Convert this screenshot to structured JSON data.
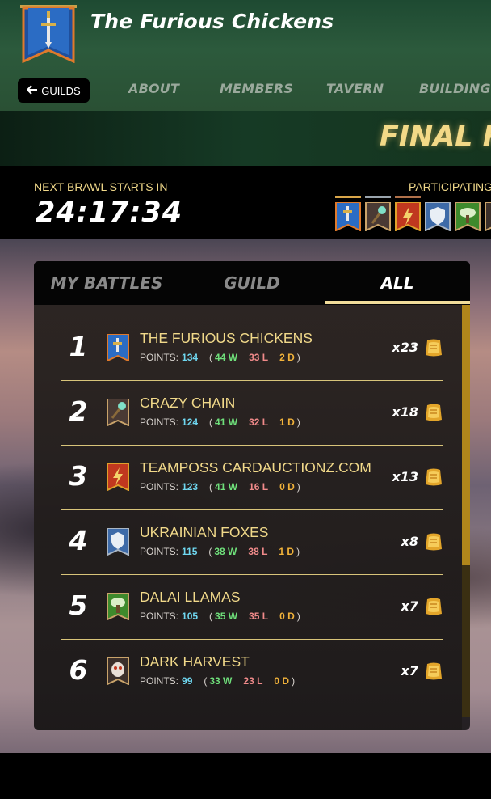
{
  "header": {
    "guild_name": "The Furious Chickens",
    "back_button_label": "GUILDS",
    "tabs": [
      {
        "label": "ABOUT"
      },
      {
        "label": "MEMBERS"
      },
      {
        "label": "TAVERN"
      },
      {
        "label": "BUILDINGS"
      }
    ]
  },
  "final_strip": {
    "text": "FINAL RE"
  },
  "brawl": {
    "next_label": "NEXT BRAWL STARTS IN",
    "timer": "24:17:34",
    "participating_label": "PARTICIPATING"
  },
  "panel": {
    "tabs": [
      {
        "label": "MY BATTLES",
        "active": false
      },
      {
        "label": "GUILD",
        "active": false
      },
      {
        "label": "ALL",
        "active": true
      }
    ],
    "points_label": "POINTS:",
    "rows": [
      {
        "rank": "1",
        "name": "THE FURIOUS CHICKENS",
        "points": "134",
        "wins": "44 W",
        "losses": "33 L",
        "draws": "2 D",
        "count": "x23",
        "banner": "sword-banner-icon"
      },
      {
        "rank": "2",
        "name": "CRAZY CHAIN",
        "points": "124",
        "wins": "41 W",
        "losses": "32 L",
        "draws": "1 D",
        "count": "x18",
        "banner": "staff-banner-icon"
      },
      {
        "rank": "3",
        "name": "TEAMPOSS CARDAUCTIONZ.COM",
        "points": "123",
        "wins": "41 W",
        "losses": "16 L",
        "draws": "0 D",
        "count": "x13",
        "banner": "lightning-banner-icon"
      },
      {
        "rank": "4",
        "name": "UKRAINIAN FOXES",
        "points": "115",
        "wins": "38 W",
        "losses": "38 L",
        "draws": "1 D",
        "count": "x8",
        "banner": "shield-banner-icon"
      },
      {
        "rank": "5",
        "name": "DALAI LLAMAS",
        "points": "105",
        "wins": "35 W",
        "losses": "35 L",
        "draws": "0 D",
        "count": "x7",
        "banner": "tree-banner-icon"
      },
      {
        "rank": "6",
        "name": "DARK HARVEST",
        "points": "99",
        "wins": "33 W",
        "losses": "23 L",
        "draws": "0 D",
        "count": "x7",
        "banner": "owl-banner-icon"
      }
    ]
  },
  "colors": {
    "accent_gold": "#f1d98a",
    "points_cyan": "#6fd7f0",
    "wins_green": "#6fe07b",
    "losses_red": "#f08a8a",
    "draws_orange": "#f2b33a"
  }
}
